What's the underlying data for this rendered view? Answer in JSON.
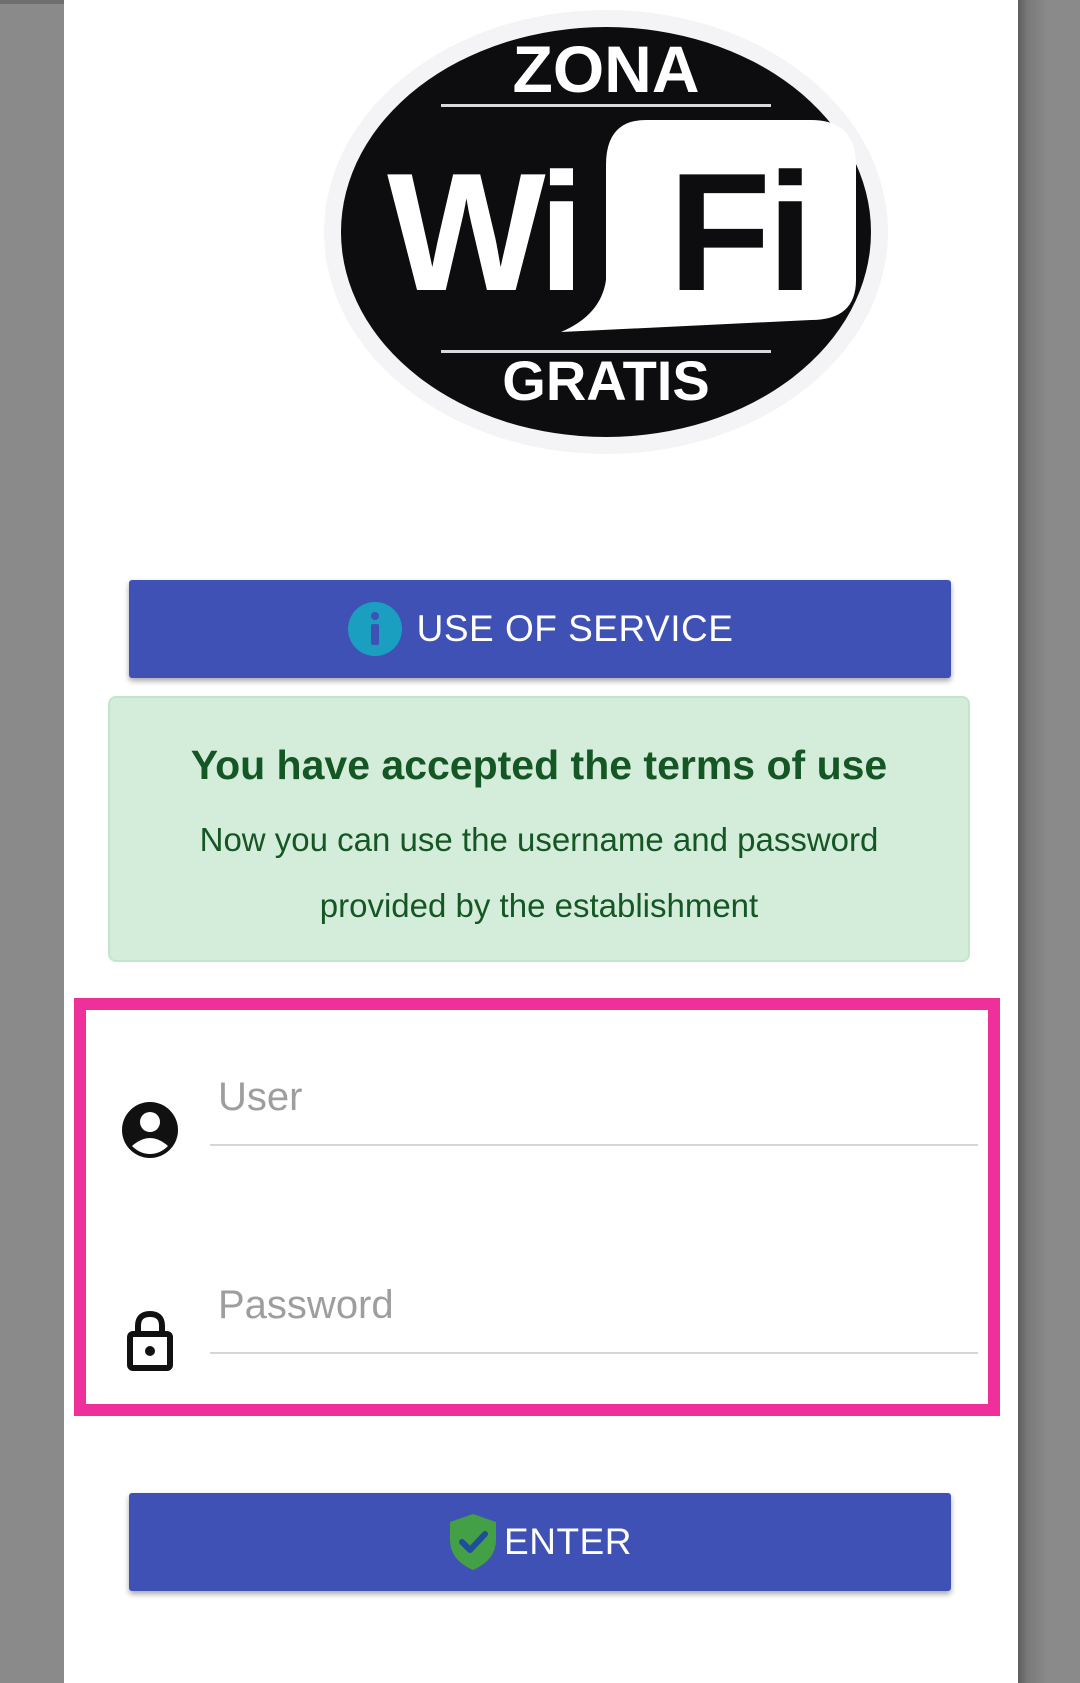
{
  "logo": {
    "top_text": "ZONA",
    "main_left": "Wi",
    "main_right": "Fi",
    "bottom_text": "GRATIS"
  },
  "service_button": {
    "label": "USE OF SERVICE",
    "icon": "info-icon",
    "icon_color": "#1a9fc0"
  },
  "alert": {
    "title": "You have accepted the terms of use",
    "body": "Now you can use the username and password provided by the establishment"
  },
  "login": {
    "user_placeholder": "User",
    "user_value": "",
    "password_placeholder": "Password",
    "password_value": ""
  },
  "enter_button": {
    "label": "ENTER",
    "icon": "shield-check-icon",
    "icon_color": "#43a047"
  },
  "colors": {
    "primary": "#3f51b5",
    "highlight": "#f0309a",
    "alert_bg": "#d4edda",
    "alert_text": "#155724"
  }
}
